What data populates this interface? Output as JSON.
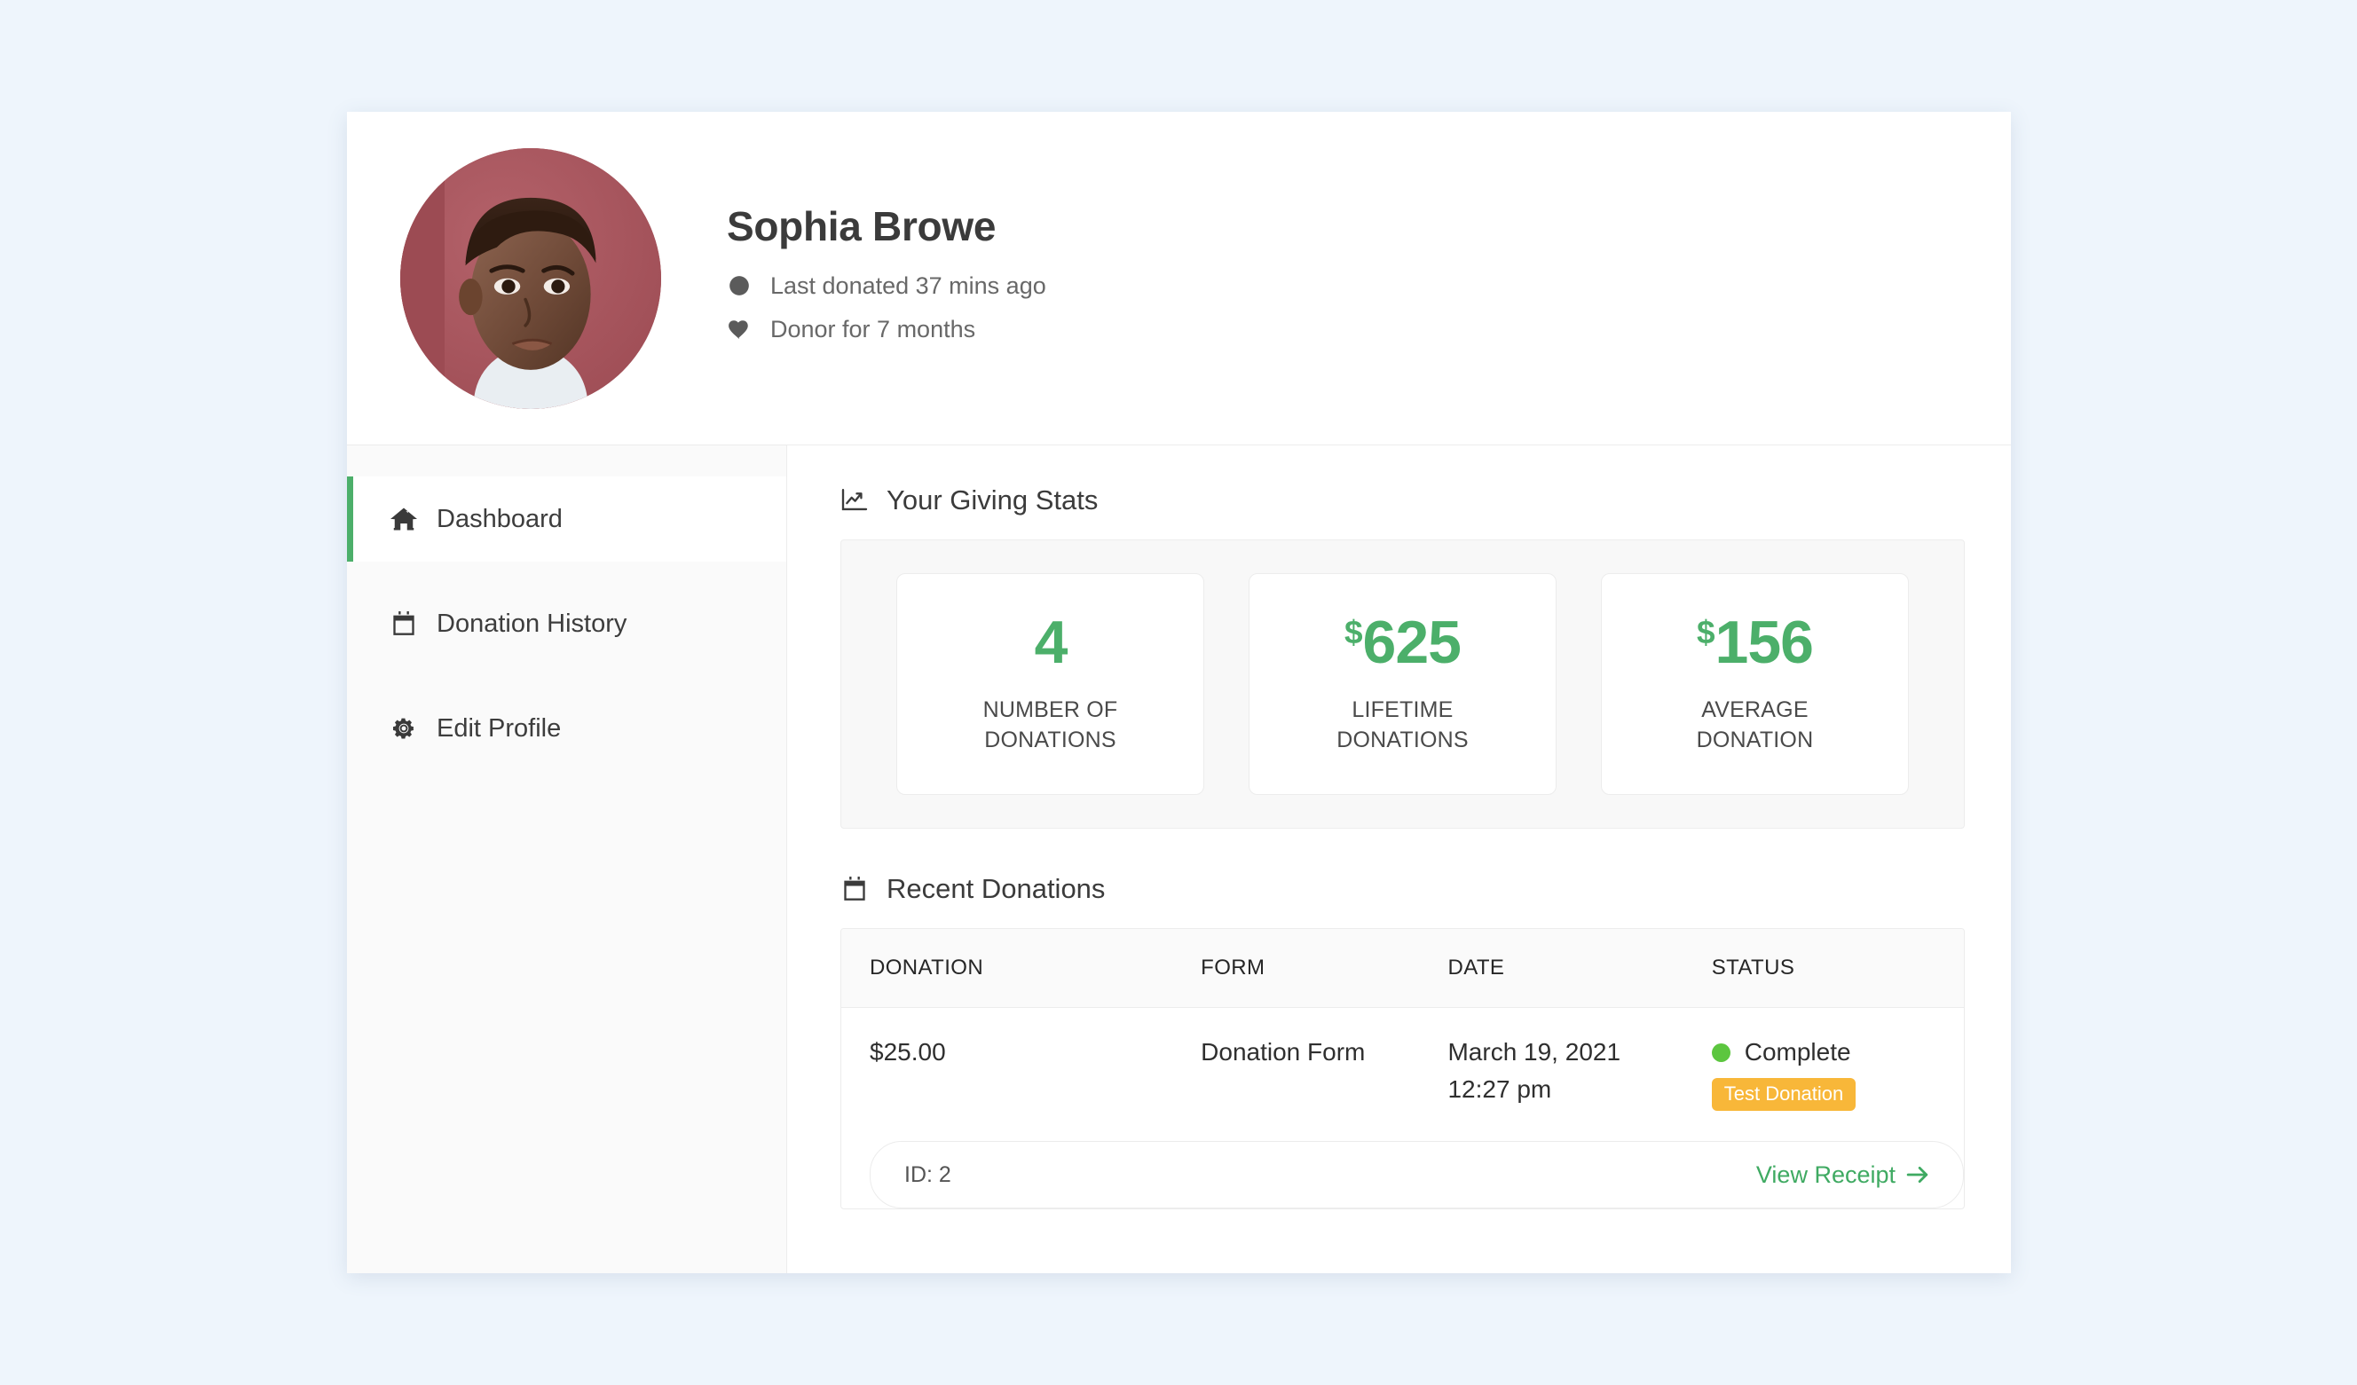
{
  "profile": {
    "name": "Sophia Browe",
    "avatar_icon": "donor-photo",
    "meta": [
      {
        "icon": "clock-icon",
        "text": "Last donated 37 mins ago"
      },
      {
        "icon": "heart-icon",
        "text": "Donor for 7 months"
      }
    ]
  },
  "sidebar": {
    "items": [
      {
        "label": "Dashboard",
        "icon": "home-icon",
        "key": "dashboard",
        "active": true
      },
      {
        "label": "Donation History",
        "icon": "calendar-icon",
        "key": "donation-history",
        "active": false
      },
      {
        "label": "Edit Profile",
        "icon": "gear-icon",
        "key": "edit-profile",
        "active": false
      }
    ]
  },
  "stats_section": {
    "title": "Your Giving Stats",
    "icon": "chart-line-icon",
    "cards": [
      {
        "currency": "",
        "value": "4",
        "label": "NUMBER OF\nDONATIONS"
      },
      {
        "currency": "$",
        "value": "625",
        "label": "LIFETIME\nDONATIONS"
      },
      {
        "currency": "$",
        "value": "156",
        "label": "AVERAGE\nDONATION"
      }
    ]
  },
  "donations_section": {
    "title": "Recent Donations",
    "icon": "calendar-icon",
    "columns": [
      "DONATION",
      "FORM",
      "DATE",
      "STATUS"
    ],
    "rows": [
      {
        "amount": "$25.00",
        "form": "Donation Form",
        "date": "March 19, 2021",
        "time": "12:27 pm",
        "status": "Complete",
        "badge": "Test Donation",
        "id_label": "ID: 2",
        "receipt_label": "View Receipt",
        "receipt_arrow": "→"
      }
    ]
  },
  "colors": {
    "accent_green": "#4caf6a",
    "status_green": "#5cc63f",
    "badge_orange": "#f8b739",
    "page_background": "#eef5fc"
  }
}
